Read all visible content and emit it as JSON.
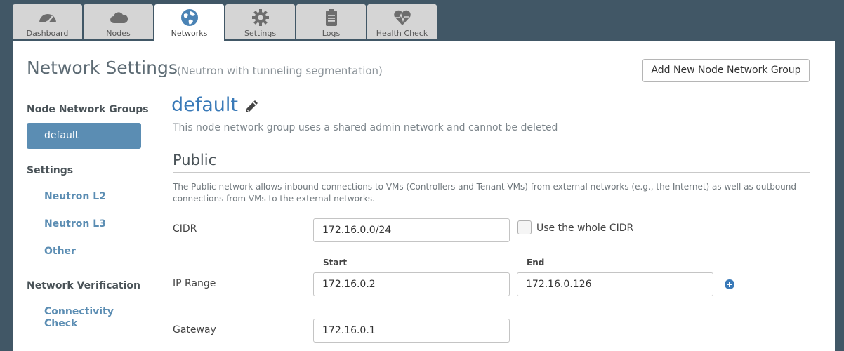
{
  "tabs": [
    {
      "label": "Dashboard",
      "icon": "dashboard-icon"
    },
    {
      "label": "Nodes",
      "icon": "cloud-icon"
    },
    {
      "label": "Networks",
      "icon": "globe-icon",
      "active": true
    },
    {
      "label": "Settings",
      "icon": "gear-icon"
    },
    {
      "label": "Logs",
      "icon": "clipboard-icon"
    },
    {
      "label": "Health Check",
      "icon": "heartbeat-icon"
    }
  ],
  "header": {
    "title": "Network Settings",
    "subtitle": "(Neutron with tunneling segmentation)",
    "add_group_label": "Add New Node Network Group"
  },
  "sidebar": {
    "groups_heading": "Node Network Groups",
    "groups": [
      "default"
    ],
    "settings_heading": "Settings",
    "settings_items": [
      "Neutron L2",
      "Neutron L3",
      "Other"
    ],
    "verification_heading": "Network Verification",
    "verification_items": [
      "Connectivity Check"
    ]
  },
  "group": {
    "name": "default",
    "note": "This node network group uses a shared admin network and cannot be deleted"
  },
  "public": {
    "title": "Public",
    "description": "The Public network allows inbound connections to VMs (Controllers and Tenant VMs) from external networks (e.g., the Internet) as well as outbound connections from VMs to the external networks.",
    "cidr_label": "CIDR",
    "cidr_value": "172.16.0.0/24",
    "use_whole_cidr_label": "Use the whole CIDR",
    "use_whole_cidr_checked": false,
    "ip_range_label": "IP Range",
    "start_label": "Start",
    "end_label": "End",
    "range_start": "172.16.0.2",
    "range_end": "172.16.0.126",
    "gateway_label": "Gateway",
    "gateway_value": "172.16.0.1"
  },
  "colors": {
    "background": "#415766",
    "accent": "#5b8db3",
    "link": "#3a7ab8"
  }
}
